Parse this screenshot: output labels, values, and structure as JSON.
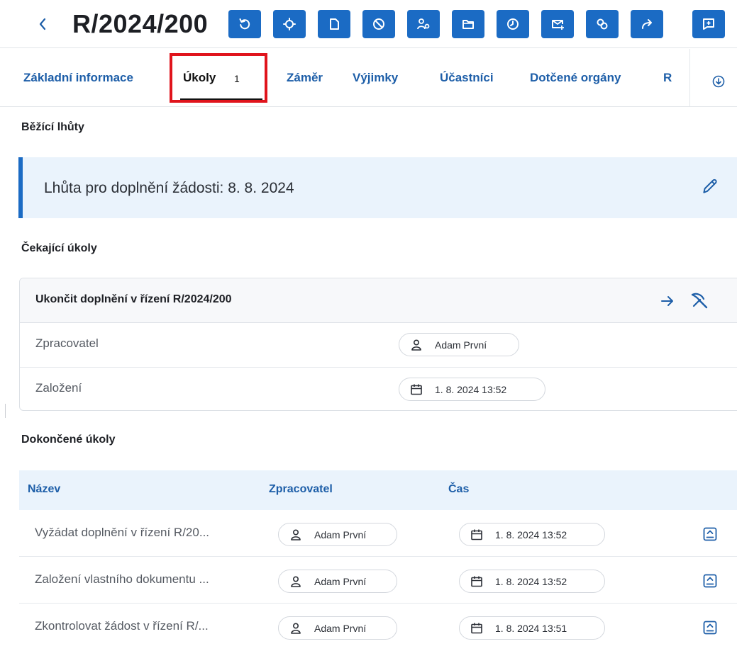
{
  "header": {
    "title": "R/2024/200",
    "toolbar_icons": [
      "refresh-icon",
      "locate-icon",
      "document-icon",
      "block-icon",
      "users-icon",
      "folder-icon",
      "clock-icon",
      "mail-add-icon",
      "link-icon",
      "forward-icon",
      "comment-add-icon"
    ],
    "accent": "#1b6bc4"
  },
  "tabs": {
    "items": [
      {
        "label": "Základní informace"
      },
      {
        "label": "Úkoly",
        "count": "1"
      },
      {
        "label": "Záměr"
      },
      {
        "label": "Výjimky"
      },
      {
        "label": "Účastníci"
      },
      {
        "label": "Dotčené orgány"
      },
      {
        "label": "R"
      }
    ],
    "active_index": 1
  },
  "running": {
    "heading": "Běžící lhůty",
    "deadline_text": "Lhůta pro doplnění žádosti: 8. 8. 2024"
  },
  "pending": {
    "heading": "Čekající úkoly",
    "card": {
      "title": "Ukončit doplnění v řízení R/2024/200",
      "processor_label": "Zpracovatel",
      "processor_value": "Adam První",
      "created_label": "Založení",
      "created_value": "1. 8. 2024 13:52"
    }
  },
  "done": {
    "heading": "Dokončené úkoly",
    "columns": [
      "Název",
      "Zpracovatel",
      "Čas"
    ],
    "rows": [
      {
        "name": "Vyžádat doplnění v řízení R/20...",
        "processor": "Adam První",
        "time": "1. 8. 2024 13:52"
      },
      {
        "name": "Založení vlastního dokumentu ...",
        "processor": "Adam První",
        "time": "1. 8. 2024 13:52"
      },
      {
        "name": "Zkontrolovat žádost v řízení R/...",
        "processor": "Adam První",
        "time": "1. 8. 2024 13:51"
      }
    ]
  }
}
